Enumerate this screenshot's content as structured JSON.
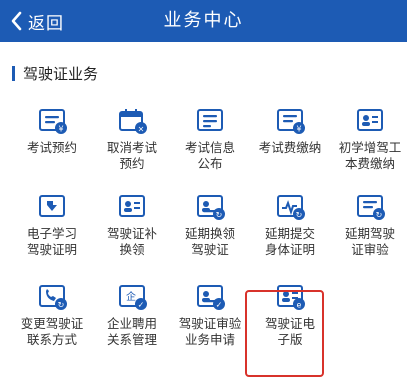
{
  "header": {
    "back_label": "返回",
    "title": "业务中心"
  },
  "section": {
    "title": "驾驶证业务"
  },
  "colors": {
    "primary": "#1d5bb4",
    "highlight": "#d8322b"
  },
  "tiles": [
    {
      "label": "考试预约",
      "icon": "exam-appointment-icon"
    },
    {
      "label": "取消考试\n预约",
      "icon": "cancel-exam-calendar-icon"
    },
    {
      "label": "考试信息\n公布",
      "icon": "exam-info-icon"
    },
    {
      "label": "考试费缴纳",
      "icon": "exam-fee-payment-icon"
    },
    {
      "label": "初学增驾工\n本费缴纳",
      "icon": "cost-payment-icon"
    },
    {
      "label": "电子学习\n驾驶证明",
      "icon": "e-learning-certificate-icon"
    },
    {
      "label": "驾驶证补\n换领",
      "icon": "license-reissue-icon"
    },
    {
      "label": "延期换领\n驾驶证",
      "icon": "license-renewal-delay-icon"
    },
    {
      "label": "延期提交\n身体证明",
      "icon": "health-certificate-delay-icon"
    },
    {
      "label": "延期驾驶\n证审验",
      "icon": "license-review-delay-icon"
    },
    {
      "label": "变更驾驶证\n联系方式",
      "icon": "contact-change-icon"
    },
    {
      "label": "企业聘用\n关系管理",
      "icon": "employment-management-icon"
    },
    {
      "label": "驾驶证审验\n业务申请",
      "icon": "license-review-application-icon"
    },
    {
      "label": "驾驶证电\n子版",
      "icon": "electronic-license-icon"
    }
  ]
}
